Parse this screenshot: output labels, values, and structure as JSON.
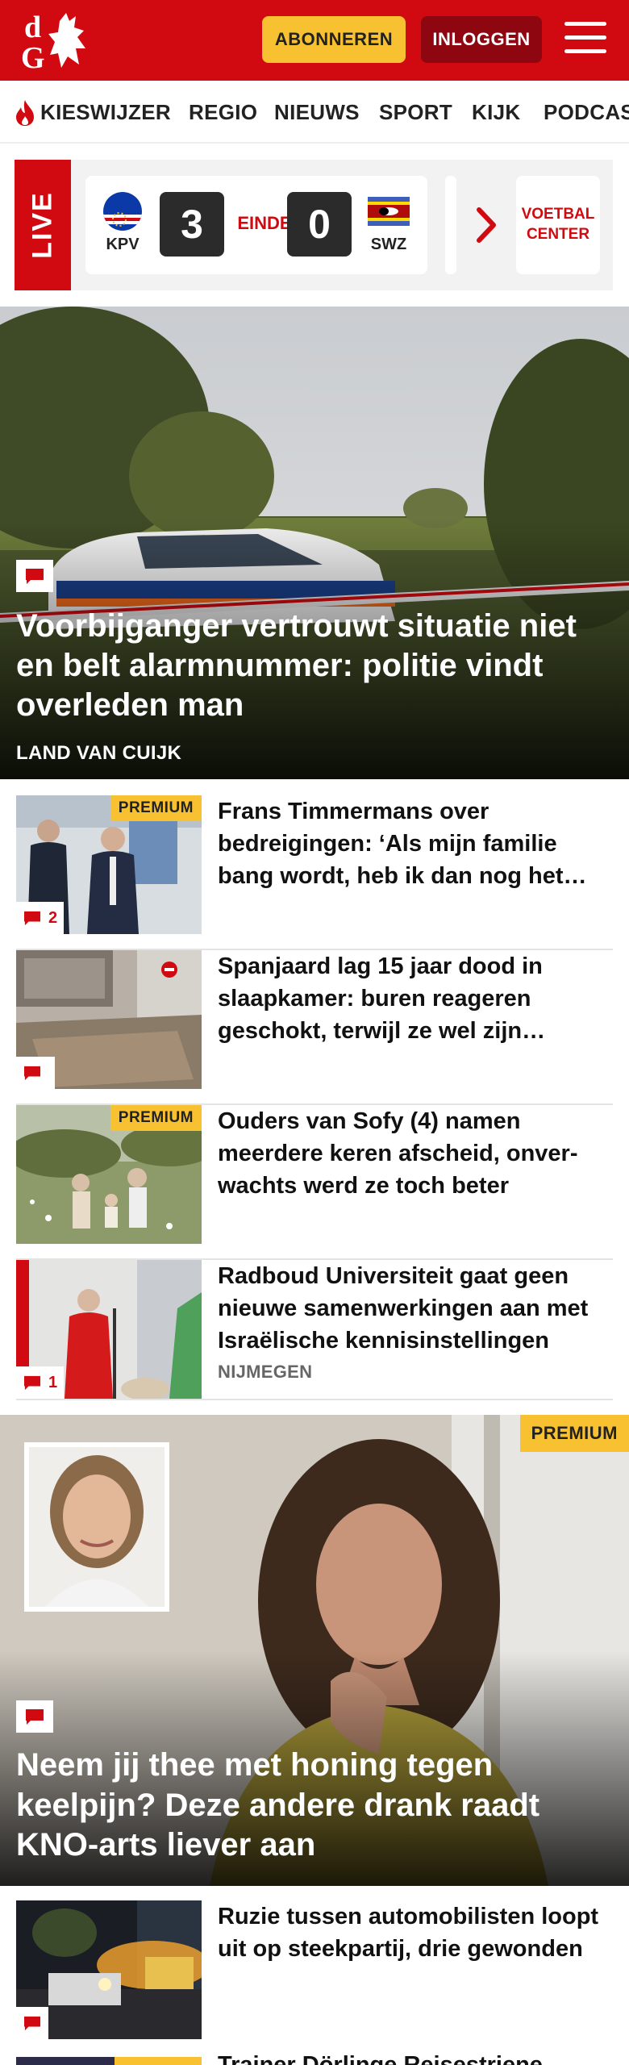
{
  "header": {
    "logo_text": "dG",
    "subscribe_label": "ABONNEREN",
    "login_label": "INLOGGEN"
  },
  "nav": {
    "items": [
      "KIESWIJZER",
      "REGIO",
      "NIEUWS",
      "SPORT",
      "KIJK",
      "PODCAST"
    ]
  },
  "live": {
    "tag": "LIVE",
    "home_team": "KPV",
    "home_score": "3",
    "status": "EINDE",
    "away_score": "0",
    "away_team": "SWZ",
    "center_label": "VOETBAL CENTER"
  },
  "hero": {
    "title": "Voorbijganger vertrouwt situatie niet en belt alarmnummer: politie vindt overleden man",
    "location": "LAND VAN CUIJK"
  },
  "articles": [
    {
      "title": "Frans Timmermans over bedreigingen: ‘Als mijn familie bang wordt, heb ik dan nog het…",
      "premium": "PREMIUM",
      "comments": "2",
      "location": ""
    },
    {
      "title": "Spanjaard lag 15 jaar dood in slaapkamer: buren reageren geschokt, terwijl ze wel zijn…",
      "premium": "",
      "comments": "",
      "location": ""
    },
    {
      "title": "Ouders van Sofy (4) namen meerdere keren afscheid, onver­wachts werd ze toch beter",
      "premium": "PREMIUM",
      "comments": "",
      "location": ""
    },
    {
      "title": "Radboud Universiteit gaat geen nieuwe samenwerkingen aan met Israëlische kennisinstellingen",
      "premium": "",
      "comments": "1",
      "location": "NIJMEGEN"
    }
  ],
  "feature": {
    "premium": "PREMIUM",
    "title": "Neem jij thee met honing tegen keelpijn? Deze andere drank raadt KNO-arts liever aan"
  },
  "article_after": {
    "title": "Ruzie tussen automobilisten loopt uit op steekpartij, drie gewonden"
  },
  "peek": {
    "title": "Trainer Dörlinge Reisestriene"
  },
  "colors": {
    "brand_red": "#d10a11",
    "premium_yellow": "#f7c132",
    "login_dark_red": "#8d0610"
  }
}
